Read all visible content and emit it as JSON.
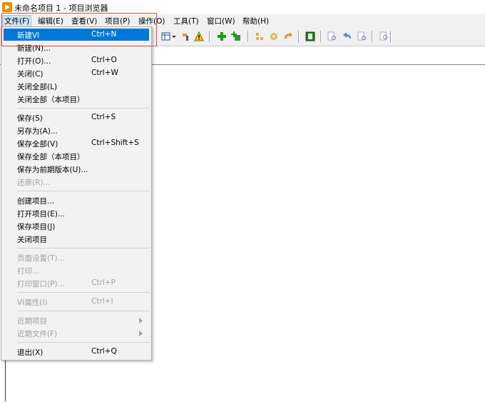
{
  "window": {
    "title": "未命名项目 1 - 项目浏览器"
  },
  "menubar": {
    "items": [
      {
        "label": "文件(F)"
      },
      {
        "label": "编辑(E)"
      },
      {
        "label": "查看(V)"
      },
      {
        "label": "项目(P)"
      },
      {
        "label": "操作(O)"
      },
      {
        "label": "工具(T)"
      },
      {
        "label": "窗口(W)"
      },
      {
        "label": "帮助(H)"
      }
    ]
  },
  "file_menu": {
    "items": [
      {
        "label": "新建VI",
        "shortcut": "Ctrl+N",
        "highlighted": true
      },
      {
        "label": "新建(N)...",
        "shortcut": ""
      },
      {
        "label": "打开(O)...",
        "shortcut": "Ctrl+O"
      },
      {
        "label": "关闭(C)",
        "shortcut": "Ctrl+W"
      },
      {
        "label": "关闭全部(L)",
        "shortcut": ""
      },
      {
        "label": "关闭全部（本项目）",
        "shortcut": ""
      },
      {
        "label": "保存(S)",
        "shortcut": "Ctrl+S"
      },
      {
        "label": "另存为(A)...",
        "shortcut": ""
      },
      {
        "label": "保存全部(V)",
        "shortcut": "Ctrl+Shift+S"
      },
      {
        "label": "保存全部（本项目）",
        "shortcut": ""
      },
      {
        "label": "保存为前期版本(U)...",
        "shortcut": ""
      },
      {
        "label": "还原(R)...",
        "shortcut": "",
        "disabled": true
      },
      {
        "label": "创建项目...",
        "shortcut": ""
      },
      {
        "label": "打开项目(E)...",
        "shortcut": ""
      },
      {
        "label": "保存项目(J)",
        "shortcut": ""
      },
      {
        "label": "关闭项目",
        "shortcut": ""
      },
      {
        "label": "页面设置(T)...",
        "shortcut": "",
        "disabled": true
      },
      {
        "label": "打印...",
        "shortcut": "",
        "disabled": true
      },
      {
        "label": "打印窗口(P)...",
        "shortcut": "Ctrl+P",
        "disabled": true
      },
      {
        "label": "VI属性(I)",
        "shortcut": "Ctrl+I",
        "disabled": true
      },
      {
        "label": "近期项目",
        "shortcut": "",
        "disabled": true,
        "submenu": true
      },
      {
        "label": "近期文件(F)",
        "shortcut": "",
        "disabled": true,
        "submenu": true
      },
      {
        "label": "退出(X)",
        "shortcut": "Ctrl+Q"
      }
    ]
  },
  "colors": {
    "highlight": "#0078d7",
    "annotation_box": "#e8433a"
  }
}
